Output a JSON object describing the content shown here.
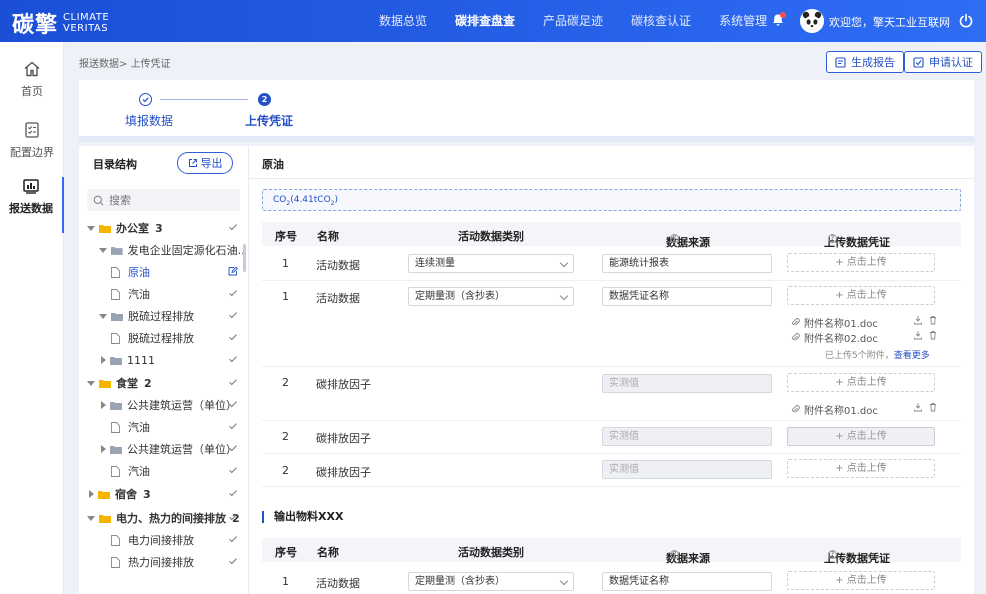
{
  "app": {
    "logo_cn": "碳擎",
    "logo_en_line1": "CLIMATE",
    "logo_en_line2": "VERITAS",
    "welcome": "欢迎您，擎天工业互联网"
  },
  "nav": [
    {
      "label": "数据总览"
    },
    {
      "label": "碳排查盘查"
    },
    {
      "label": "产品碳足迹"
    },
    {
      "label": "碳核查认证"
    },
    {
      "label": "系统管理"
    }
  ],
  "leftnav": [
    {
      "label": "首页"
    },
    {
      "label": "配置边界"
    },
    {
      "label": "报送数据"
    }
  ],
  "breadcrumb": "报送数据> 上传凭证",
  "header_buttons": {
    "report": "生成报告",
    "apply": "申请认证"
  },
  "steps": [
    {
      "label": "填报数据",
      "number": ""
    },
    {
      "label": "上传凭证",
      "number": "2"
    }
  ],
  "tree": {
    "title": "目录结构",
    "export_label": "导出",
    "search_placeholder": "搜索",
    "rows": [
      {
        "label": "办公室",
        "count": "3"
      },
      {
        "label": "发电企业固定源化石油..."
      },
      {
        "label": "原油"
      },
      {
        "label": "汽油"
      },
      {
        "label": "脱硫过程排放"
      },
      {
        "label": "脱硫过程排放"
      },
      {
        "label": "1111"
      },
      {
        "label": "食堂",
        "count": "2"
      },
      {
        "label": "公共建筑运营（单位）"
      },
      {
        "label": "汽油"
      },
      {
        "label": "公共建筑运营（单位）"
      },
      {
        "label": "汽油"
      },
      {
        "label": "宿舍",
        "count": "3"
      },
      {
        "label": "电力、热力的间接排放",
        "count": "2"
      },
      {
        "label": "电力间接排放"
      },
      {
        "label": "热力间接排放"
      }
    ]
  },
  "main": {
    "section_title": "原油",
    "co2_prefix": "CO",
    "co2_sub": "2",
    "co2_value": "(4.41tCO",
    "co2_value_sub": "2",
    "co2_close": ")",
    "columns": {
      "no": "序号",
      "name": "名称",
      "type": "活动数据类别",
      "source": "数据来源",
      "upload": "上传数据凭证"
    },
    "rows": [
      {
        "no": "1",
        "name": "活动数据",
        "type": "连续测量",
        "source": "能源统计报表",
        "upload": "+ 点击上传"
      },
      {
        "no": "1",
        "name": "活动数据",
        "type": "定期量测（含抄表）",
        "source": "数据凭证名称",
        "upload": "+ 点击上传"
      },
      {
        "no": "2",
        "name": "碳排放因子",
        "source": "实测值",
        "upload": "+ 点击上传"
      },
      {
        "no": "2",
        "name": "碳排放因子",
        "source": "实测值",
        "upload": "+ 点击上传"
      },
      {
        "no": "2",
        "name": "碳排放因子",
        "source": "实测值",
        "upload": "+ 点击上传"
      }
    ],
    "attachments_row2": [
      "附件名称01.doc",
      "附件名称02.doc"
    ],
    "more_note": "已上传5个附件，",
    "more_link": "查看更多",
    "attachments_row3": [
      "附件名称01.doc"
    ],
    "output_title": "输出物料XXX",
    "output_row": {
      "no": "1",
      "name": "活动数据",
      "type": "定期量测（含抄表）",
      "source": "数据凭证名称",
      "upload": "+ 点击上传"
    }
  },
  "colors": {
    "primary": "#2f6df5",
    "accent": "#2450c8"
  }
}
